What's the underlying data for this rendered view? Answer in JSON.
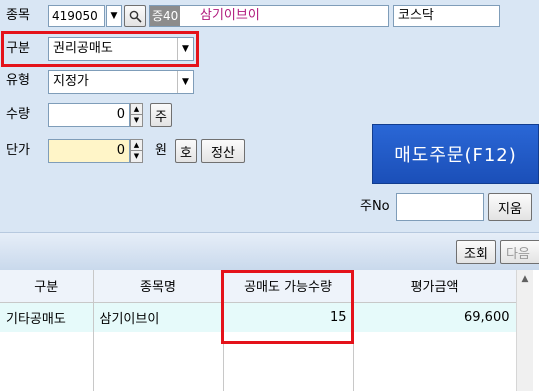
{
  "form": {
    "code_label": "종목",
    "code_value": "419050",
    "code_prefix": "증40",
    "code_name": "삼기이브이",
    "market": "코스닥",
    "type_label": "구분",
    "type_value": "권리공매도",
    "kind_label": "유형",
    "kind_value": "지정가",
    "qty_label": "수량",
    "qty_value": "0",
    "qty_unit": "주",
    "price_label": "단가",
    "price_value": "0",
    "price_unit": "원",
    "hoga_button": "호",
    "settle_button": "정산",
    "order_button": "매도주문(F12)",
    "order_no_label": "주No",
    "order_no_value": "",
    "clear_button": "지움"
  },
  "toolbar": {
    "query_button": "조회",
    "next_button": "다음"
  },
  "table": {
    "headers": [
      "구분",
      "종목명",
      "공매도 가능수량",
      "평가금액"
    ],
    "rows": [
      {
        "type": "기타공매도",
        "name": "삼기이브이",
        "qty": "15",
        "amount": "69,600"
      }
    ]
  },
  "colors": {
    "accent_blue": "#1e57c6",
    "highlight_red": "#e4121a",
    "code_name_color": "#b0187c"
  },
  "icons": {
    "search": "search-icon",
    "dropdown": "chevron-down-icon",
    "spin_up": "arrow-up-icon",
    "spin_down": "arrow-down-icon",
    "scroll_up": "scroll-up-icon"
  }
}
